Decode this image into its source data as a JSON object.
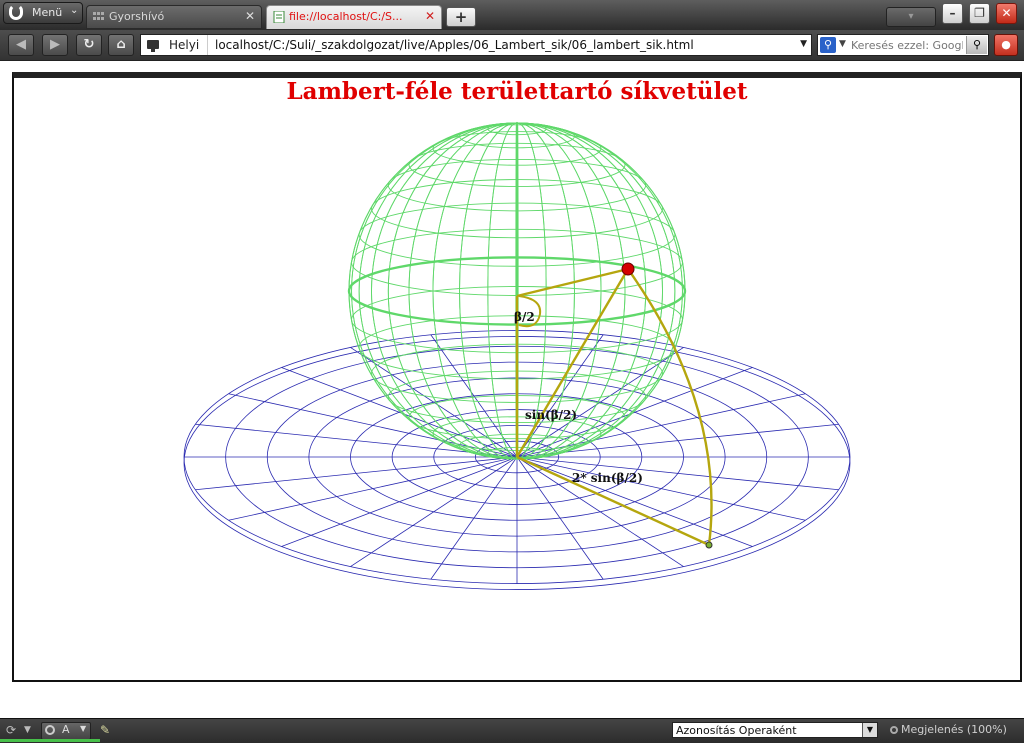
{
  "browser": {
    "menu_label": "Menü",
    "tabs": [
      {
        "title": "Gyorshívó",
        "active": false,
        "icon": "speed-dial-icon"
      },
      {
        "title": "file://localhost/C:/S...",
        "active": true,
        "icon": "document-icon"
      }
    ],
    "new_tab_symbol": "+",
    "address": {
      "site_label": "Helyi",
      "url": "localhost/C:/Suli/_szakdolgozat/live/Apples/06_Lambert_sik/06_lambert_sik.html"
    },
    "search": {
      "placeholder": "Keresés ezzel: Google",
      "engine": "google"
    }
  },
  "page": {
    "title": "Lambert-féle területtartó síkvetület",
    "labels": {
      "half_angle": "β/2",
      "sine": "sin(β/2)",
      "double_sine": "2* sin(β/2)"
    },
    "colors": {
      "title": "#e00000",
      "sphere": "#5fd86a",
      "plane": "#2a2ab0",
      "construction": "#b5a60e",
      "point": "#d40000"
    }
  },
  "statusbar": {
    "opera_label": "A",
    "identify_as": "Azonosítás Operaként",
    "zoom": "Megjelenés (100%)"
  }
}
